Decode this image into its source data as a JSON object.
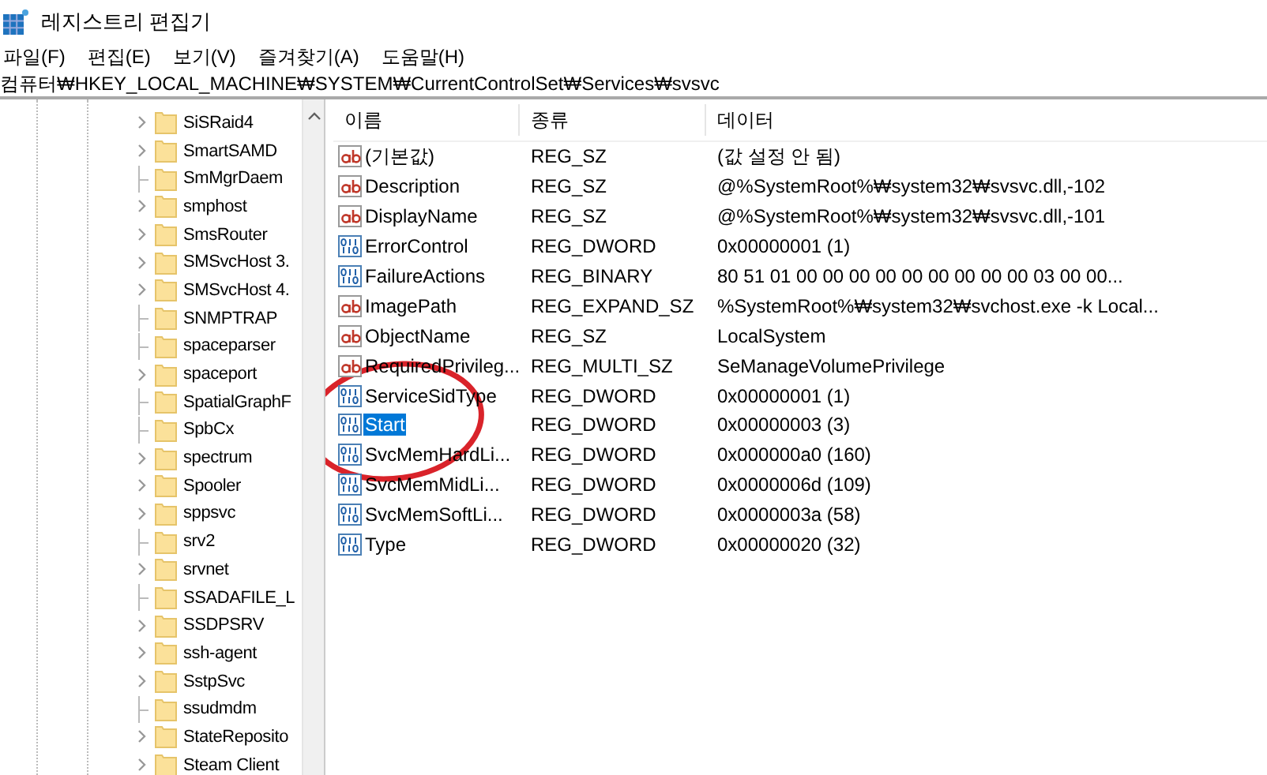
{
  "window": {
    "title": "레지스트리 편집기"
  },
  "menu": [
    "파일(F)",
    "편집(E)",
    "보기(V)",
    "즐겨찾기(A)",
    "도움말(H)"
  ],
  "address": "컴퓨터₩HKEY_LOCAL_MACHINE₩SYSTEM₩CurrentControlSet₩Services₩svsvc",
  "tree": {
    "items": [
      {
        "label": "SiSRaid4",
        "expandable": true
      },
      {
        "label": "SmartSAMD",
        "expandable": true
      },
      {
        "label": "SmMgrDaem",
        "expandable": false
      },
      {
        "label": "smphost",
        "expandable": true
      },
      {
        "label": "SmsRouter",
        "expandable": true
      },
      {
        "label": "SMSvcHost 3.",
        "expandable": true
      },
      {
        "label": "SMSvcHost 4.",
        "expandable": true
      },
      {
        "label": "SNMPTRAP",
        "expandable": false
      },
      {
        "label": "spaceparser",
        "expandable": false
      },
      {
        "label": "spaceport",
        "expandable": true
      },
      {
        "label": "SpatialGraphF",
        "expandable": false
      },
      {
        "label": "SpbCx",
        "expandable": false
      },
      {
        "label": "spectrum",
        "expandable": true
      },
      {
        "label": "Spooler",
        "expandable": true
      },
      {
        "label": "sppsvc",
        "expandable": true
      },
      {
        "label": "srv2",
        "expandable": false
      },
      {
        "label": "srvnet",
        "expandable": true
      },
      {
        "label": "SSADAFILE_L",
        "expandable": false
      },
      {
        "label": "SSDPSRV",
        "expandable": true
      },
      {
        "label": "ssh-agent",
        "expandable": true
      },
      {
        "label": "SstpSvc",
        "expandable": true
      },
      {
        "label": "ssudmdm",
        "expandable": false
      },
      {
        "label": "StateReposito",
        "expandable": true
      },
      {
        "label": "Steam Client",
        "expandable": true
      }
    ]
  },
  "values": {
    "columns": [
      "이름",
      "종류",
      "데이터"
    ],
    "rows": [
      {
        "kind": "string",
        "name": "(기본값)",
        "type": "REG_SZ",
        "data": "(값 설정 안 됨)",
        "selected": false
      },
      {
        "kind": "string",
        "name": "Description",
        "type": "REG_SZ",
        "data": "@%SystemRoot%₩system32₩svsvc.dll,-102",
        "selected": false
      },
      {
        "kind": "string",
        "name": "DisplayName",
        "type": "REG_SZ",
        "data": "@%SystemRoot%₩system32₩svsvc.dll,-101",
        "selected": false
      },
      {
        "kind": "binary",
        "name": "ErrorControl",
        "type": "REG_DWORD",
        "data": "0x00000001 (1)",
        "selected": false
      },
      {
        "kind": "binary",
        "name": "FailureActions",
        "type": "REG_BINARY",
        "data": "80 51 01 00 00 00 00 00 00 00 00 00 03 00 00...",
        "selected": false
      },
      {
        "kind": "string",
        "name": "ImagePath",
        "type": "REG_EXPAND_SZ",
        "data": "%SystemRoot%₩system32₩svchost.exe -k Local...",
        "selected": false
      },
      {
        "kind": "string",
        "name": "ObjectName",
        "type": "REG_SZ",
        "data": "LocalSystem",
        "selected": false
      },
      {
        "kind": "string",
        "name": "RequiredPrivileg...",
        "type": "REG_MULTI_SZ",
        "data": "SeManageVolumePrivilege",
        "selected": false
      },
      {
        "kind": "binary",
        "name": "ServiceSidType",
        "type": "REG_DWORD",
        "data": "0x00000001 (1)",
        "selected": false
      },
      {
        "kind": "binary",
        "name": "Start",
        "type": "REG_DWORD",
        "data": "0x00000003 (3)",
        "selected": true
      },
      {
        "kind": "binary",
        "name": "SvcMemHardLi...",
        "type": "REG_DWORD",
        "data": "0x000000a0 (160)",
        "selected": false
      },
      {
        "kind": "binary",
        "name": "SvcMemMidLi...",
        "type": "REG_DWORD",
        "data": "0x0000006d (109)",
        "selected": false
      },
      {
        "kind": "binary",
        "name": "SvcMemSoftLi...",
        "type": "REG_DWORD",
        "data": "0x0000003a (58)",
        "selected": false
      },
      {
        "kind": "binary",
        "name": "Type",
        "type": "REG_DWORD",
        "data": "0x00000020 (32)",
        "selected": false
      }
    ]
  }
}
